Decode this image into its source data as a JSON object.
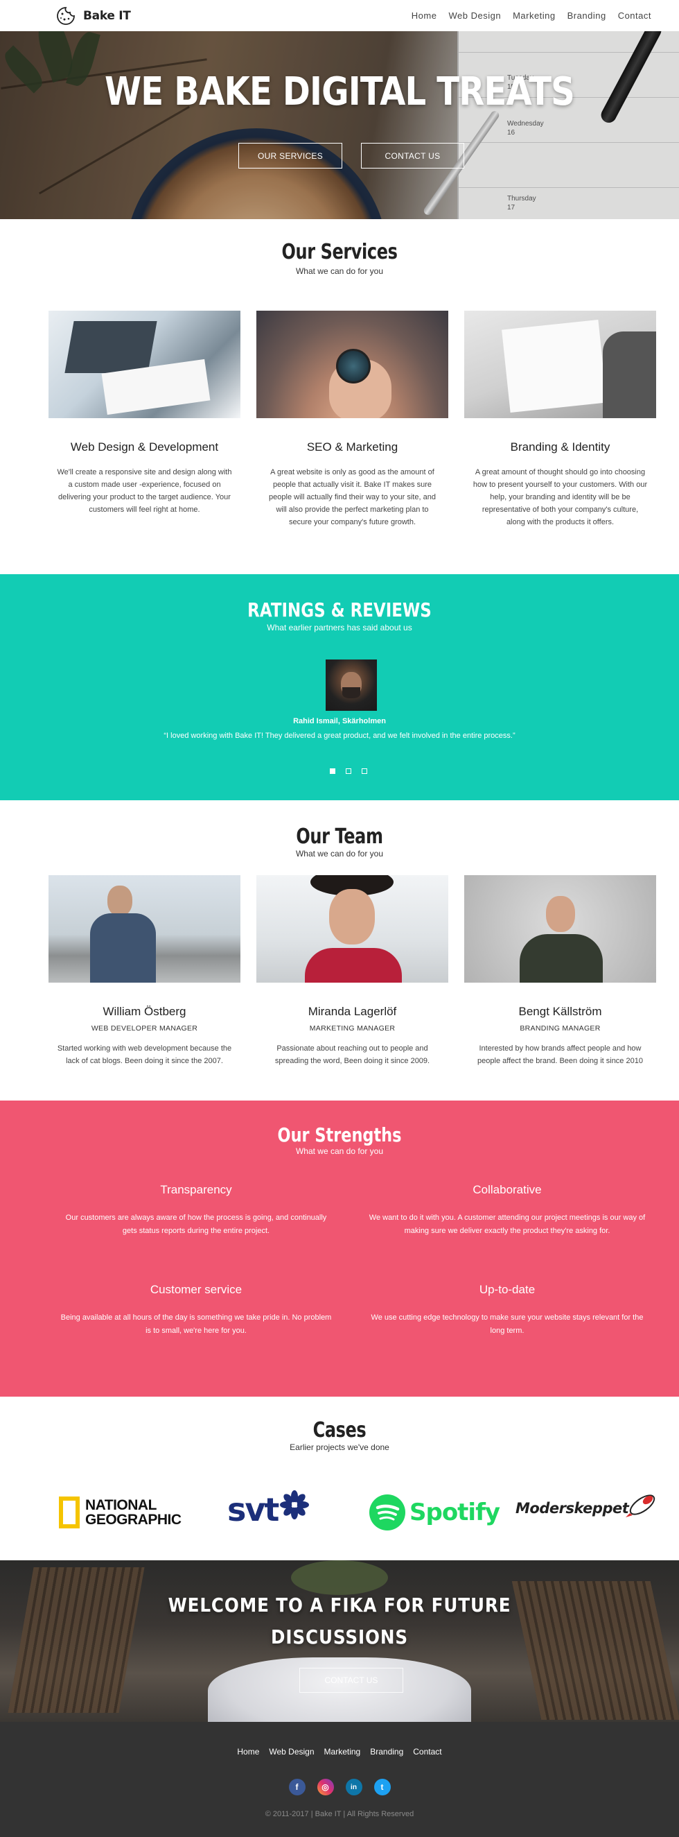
{
  "nav": {
    "brand": "Bake IT",
    "logo_icon": "cookie-icon",
    "items": [
      "Home",
      "Web Design",
      "Marketing",
      "Branding",
      "Contact"
    ]
  },
  "hero": {
    "title": "WE BAKE DIGITAL TREATS",
    "btn_services": "OUR SERVICES",
    "btn_contact": "CONTACT US",
    "notebook_lines": [
      "Tuesday",
      "15",
      "Wednesday",
      "16",
      "Thursday",
      "17"
    ]
  },
  "services": {
    "title": "Our Services",
    "subtitle": "What we can do for you",
    "cards": [
      {
        "title": "Web Design & Development",
        "text": "We'll create a responsive site and design along with a custom made user -experience, focused on delivering your product to the target audience. Your customers will feel right at home."
      },
      {
        "title": "SEO & Marketing",
        "text": "A great website is only as good as the amount of people that actually visit it. Bake IT makes sure people will actually find their way to your site, and will also provide the perfect marketing plan to secure your company's future growth."
      },
      {
        "title": "Branding & Identity",
        "text": "A great amount of thought should go into choosing how to present yourself to your customers. With our help, your branding and identity will be be representative of both your company's culture, along with the products it offers."
      }
    ]
  },
  "ratings": {
    "title": "RATINGS & REVIEWS",
    "subtitle": "What earlier partners has said about us",
    "author": "Rahid Ismail, Skärholmen",
    "quote": "“I loved working with Bake IT! They delivered a great product, and we felt involved in the entire process.”"
  },
  "team": {
    "title": "Our Team",
    "subtitle": "What we can do for you",
    "members": [
      {
        "name": "William Östberg",
        "role": "WEB DEVELOPER MANAGER",
        "text": "Started working with web development because the lack of cat blogs. Been doing it since the 2007."
      },
      {
        "name": "Miranda Lagerlöf",
        "role": "MARKETING MANAGER",
        "text": "Passionate about reaching out to people and spreading the word, Been doing it since 2009."
      },
      {
        "name": "Bengt Källström",
        "role": "BRANDING MANAGER",
        "text": "Interested by how brands affect people and how people affect the brand. Been doing it since 2010"
      }
    ]
  },
  "strengths": {
    "title": "Our Strengths",
    "subtitle": "What we can do for you",
    "items": [
      {
        "title": "Transparency",
        "text": "Our customers are always aware of how the process is going, and continually gets status reports during the entire project."
      },
      {
        "title": "Collaborative",
        "text": "We want to do it with you. A customer attending our project meetings is our way of making sure we deliver exactly the product they're asking for."
      },
      {
        "title": "Customer service",
        "text": "Being available at all hours of the day is something we take pride in. No problem is to small, we're here for you."
      },
      {
        "title": "Up-to-date",
        "text": "We use cutting edge technology to make sure your website stays relevant for the long term."
      }
    ]
  },
  "cases": {
    "title": "Cases",
    "subtitle": "Earlier projects we've done",
    "natgeo_line1": "NATIONAL",
    "natgeo_line2": "GEOGRAPHIC",
    "svt": "svt",
    "spotify": "Spotify",
    "moderskeppet": "Moderskeppet"
  },
  "welcome": {
    "line1": "WELCOME TO A FIKA FOR FUTURE",
    "line2": "DISCUSSIONS",
    "button": "CONTACT US"
  },
  "footer": {
    "items": [
      "Home",
      "Web Design",
      "Marketing",
      "Branding",
      "Contact"
    ],
    "social": {
      "facebook": "f",
      "instagram": "◎",
      "linkedin": "in",
      "twitter": "t"
    },
    "copyright": "© 2011-2017 | Bake IT | All Rights Reserved"
  },
  "colors": {
    "ratings_bg": "#12ccb4",
    "strengths_bg": "#f05671",
    "footer_bg": "#333333"
  }
}
